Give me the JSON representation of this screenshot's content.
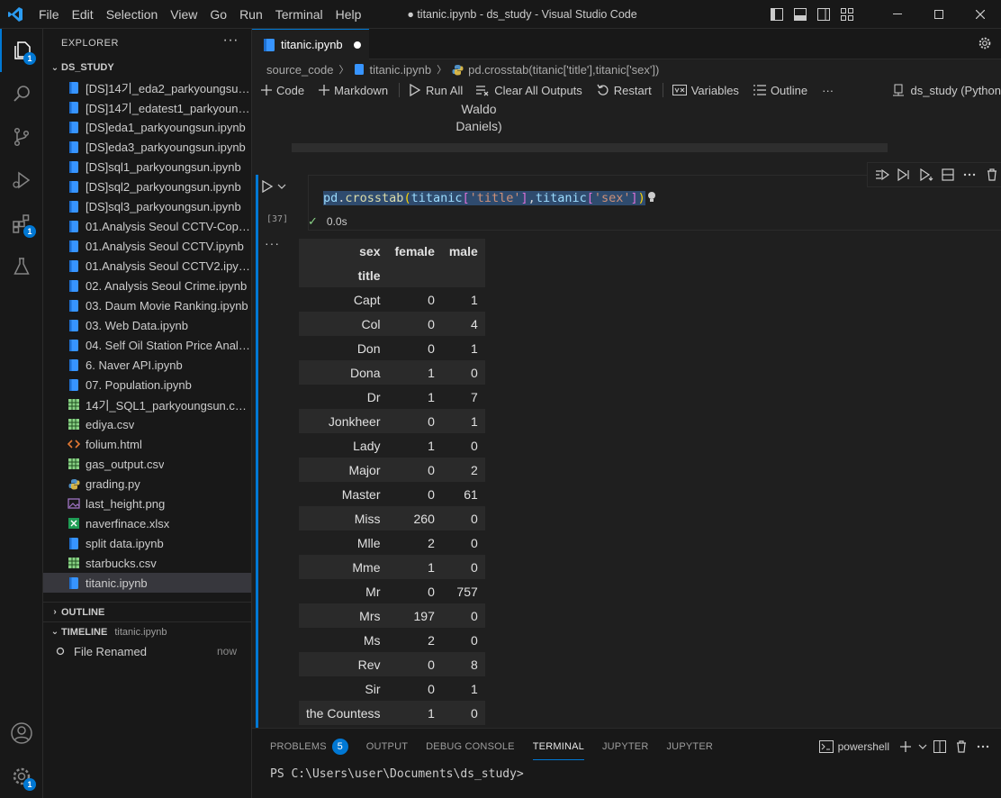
{
  "window": {
    "title": "● titanic.ipynb - ds_study - Visual Studio Code",
    "menu": [
      "File",
      "Edit",
      "Selection",
      "View",
      "Go",
      "Run",
      "Terminal",
      "Help"
    ]
  },
  "activity": {
    "explorer_badge": "1",
    "extensions_badge": "1",
    "settings_badge": "1"
  },
  "explorer": {
    "header": "EXPLORER",
    "more": "···",
    "folder": "DS_STUDY",
    "files": [
      {
        "name": "[DS]14기_eda2_parkyoungsun.i...",
        "icon": "notebook-icon"
      },
      {
        "name": "[DS]14기_edatest1_parkyoungs...",
        "icon": "notebook-icon"
      },
      {
        "name": "[DS]eda1_parkyoungsun.ipynb",
        "icon": "notebook-icon"
      },
      {
        "name": "[DS]eda3_parkyoungsun.ipynb",
        "icon": "notebook-icon"
      },
      {
        "name": "[DS]sql1_parkyoungsun.ipynb",
        "icon": "notebook-icon"
      },
      {
        "name": "[DS]sql2_parkyoungsun.ipynb",
        "icon": "notebook-icon"
      },
      {
        "name": "[DS]sql3_parkyoungsun.ipynb",
        "icon": "notebook-icon"
      },
      {
        "name": "01.Analysis Seoul CCTV-Copy1....",
        "icon": "notebook-icon"
      },
      {
        "name": "01.Analysis Seoul CCTV.ipynb",
        "icon": "notebook-icon"
      },
      {
        "name": "01.Analysis Seoul CCTV2.ipynb",
        "icon": "notebook-icon"
      },
      {
        "name": "02. Analysis Seoul Crime.ipynb",
        "icon": "notebook-icon"
      },
      {
        "name": "03. Daum Movie Ranking.ipynb",
        "icon": "notebook-icon"
      },
      {
        "name": "03. Web Data.ipynb",
        "icon": "notebook-icon"
      },
      {
        "name": "04. Self Oil Station Price Analys...",
        "icon": "notebook-icon"
      },
      {
        "name": "6. Naver API.ipynb",
        "icon": "notebook-icon"
      },
      {
        "name": "07. Population.ipynb",
        "icon": "notebook-icon"
      },
      {
        "name": "14기_SQL1_parkyoungsun.csv.c...",
        "icon": "csv-icon"
      },
      {
        "name": "ediya.csv",
        "icon": "csv-icon"
      },
      {
        "name": "folium.html",
        "icon": "html-icon"
      },
      {
        "name": "gas_output.csv",
        "icon": "csv-icon"
      },
      {
        "name": "grading.py",
        "icon": "python-icon"
      },
      {
        "name": "last_height.png",
        "icon": "image-icon"
      },
      {
        "name": "naverfinace.xlsx",
        "icon": "excel-icon"
      },
      {
        "name": "split data.ipynb",
        "icon": "notebook-icon"
      },
      {
        "name": "starbucks.csv",
        "icon": "csv-icon"
      },
      {
        "name": "titanic.ipynb",
        "icon": "notebook-icon"
      }
    ],
    "outline_label": "OUTLINE",
    "timeline_label": "TIMELINE",
    "timeline_file": "titanic.ipynb",
    "timeline_item": "File Renamed",
    "timeline_time": "now"
  },
  "editor": {
    "tab_label": "titanic.ipynb",
    "breadcrumb": [
      "source_code",
      "titanic.ipynb",
      "pd.crosstab(titanic['title'],titanic['sex'])"
    ],
    "toolbar": {
      "code": "Code",
      "markdown": "Markdown",
      "run_all": "Run All",
      "clear_outputs": "Clear All Outputs",
      "restart": "Restart",
      "variables": "Variables",
      "outline": "Outline",
      "more": "···",
      "kernel": "ds_study (Python"
    },
    "prev_output": [
      "Waldo",
      "Daniels)"
    ],
    "cell": {
      "exec_count": "[37]",
      "code_parts": {
        "a": "pd",
        "b": ".",
        "c": "crosstab",
        "d": "(",
        "e": "titanic",
        "f": "[",
        "g": "'title'",
        "h": "]",
        "i": ",",
        "j": "titanic",
        "k": "[",
        "l": "'sex'",
        "m": "]",
        "n": ")"
      },
      "duration": "0.0s",
      "output_more": "···"
    },
    "output_table": {
      "col_header": "sex",
      "index_header": "title",
      "columns": [
        "female",
        "male"
      ],
      "rows": [
        {
          "title": "Capt",
          "female": "0",
          "male": "1"
        },
        {
          "title": "Col",
          "female": "0",
          "male": "4"
        },
        {
          "title": "Don",
          "female": "0",
          "male": "1"
        },
        {
          "title": "Dona",
          "female": "1",
          "male": "0"
        },
        {
          "title": "Dr",
          "female": "1",
          "male": "7"
        },
        {
          "title": "Jonkheer",
          "female": "0",
          "male": "1"
        },
        {
          "title": "Lady",
          "female": "1",
          "male": "0"
        },
        {
          "title": "Major",
          "female": "0",
          "male": "2"
        },
        {
          "title": "Master",
          "female": "0",
          "male": "61"
        },
        {
          "title": "Miss",
          "female": "260",
          "male": "0"
        },
        {
          "title": "Mlle",
          "female": "2",
          "male": "0"
        },
        {
          "title": "Mme",
          "female": "1",
          "male": "0"
        },
        {
          "title": "Mr",
          "female": "0",
          "male": "757"
        },
        {
          "title": "Mrs",
          "female": "197",
          "male": "0"
        },
        {
          "title": "Ms",
          "female": "2",
          "male": "0"
        },
        {
          "title": "Rev",
          "female": "0",
          "male": "8"
        },
        {
          "title": "Sir",
          "female": "0",
          "male": "1"
        },
        {
          "title": "the Countess",
          "female": "1",
          "male": "0"
        }
      ]
    }
  },
  "panel": {
    "tabs": [
      "PROBLEMS",
      "OUTPUT",
      "DEBUG CONSOLE",
      "TERMINAL",
      "JUPYTER",
      "JUPYTER"
    ],
    "problems_count": "5",
    "active_tab": "TERMINAL",
    "shell": "powershell",
    "prompt": "PS C:\\Users\\user\\Documents\\ds_study>"
  },
  "colors": {
    "accent": "#0078d4",
    "background": "#1f1f1f",
    "sidebar": "#181818"
  }
}
